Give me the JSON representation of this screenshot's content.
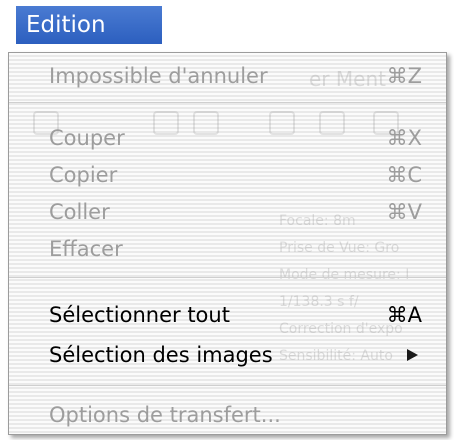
{
  "menu_title": "Edition",
  "background_ghost": {
    "lines": [
      "Focale: 8m",
      "Prise de Vue: Gro",
      "Mode de mesure: I",
      "1/138.3 s f/",
      "Correction d'expo",
      "Sensibilité: Auto"
    ],
    "title_fragment": "er Ment"
  },
  "items": [
    {
      "label": "Impossible d'annuler",
      "shortcut": "⌘Z",
      "enabled": false
    },
    {
      "label": "Couper",
      "shortcut": "⌘X",
      "enabled": false
    },
    {
      "label": "Copier",
      "shortcut": "⌘C",
      "enabled": false
    },
    {
      "label": "Coller",
      "shortcut": "⌘V",
      "enabled": false
    },
    {
      "label": "Effacer",
      "shortcut": "",
      "enabled": false
    },
    {
      "label": "Sélectionner tout",
      "shortcut": "⌘A",
      "enabled": true
    },
    {
      "label": "Sélection des images",
      "shortcut": "",
      "enabled": true,
      "submenu": true
    },
    {
      "label": "Options de transfert...",
      "shortcut": "",
      "enabled": false
    }
  ],
  "colors": {
    "title_bg": "#2c5fbf",
    "disabled_text": "#9d9d9d",
    "enabled_text": "#000000"
  }
}
